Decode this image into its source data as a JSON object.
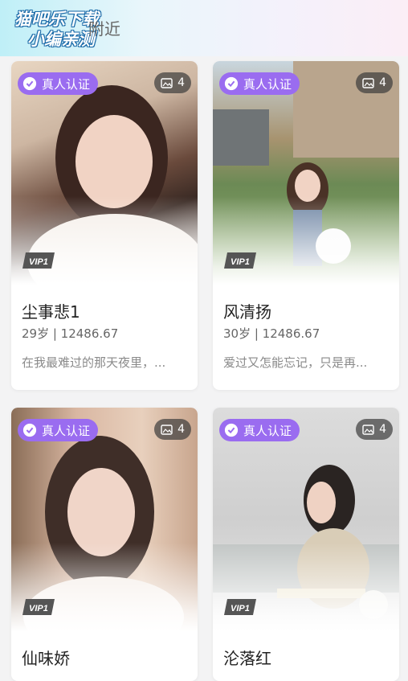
{
  "header": {
    "watermark_line1": "猫吧乐下载",
    "watermark_line2": "小编亲测",
    "tab_label": "附近"
  },
  "colors": {
    "badge": "#9a6cf0",
    "count_bg": "#3c3c3c"
  },
  "cards": [
    {
      "badge": "真人认证",
      "photo_count": "4",
      "vip": "VIP1",
      "name": "尘事悲1",
      "meta": "29岁 | 12486.67",
      "bio": "在我最难过的那天夜里，..."
    },
    {
      "badge": "真人认证",
      "photo_count": "4",
      "vip": "VIP1",
      "name": "风清扬",
      "meta": "30岁 | 12486.67",
      "bio": "爱过又怎能忘记，只是再..."
    },
    {
      "badge": "真人认证",
      "photo_count": "4",
      "vip": "VIP1",
      "name": "仙味娇",
      "meta": "",
      "bio": ""
    },
    {
      "badge": "真人认证",
      "photo_count": "4",
      "vip": "VIP1",
      "name": "沦落红",
      "meta": "",
      "bio": ""
    }
  ]
}
